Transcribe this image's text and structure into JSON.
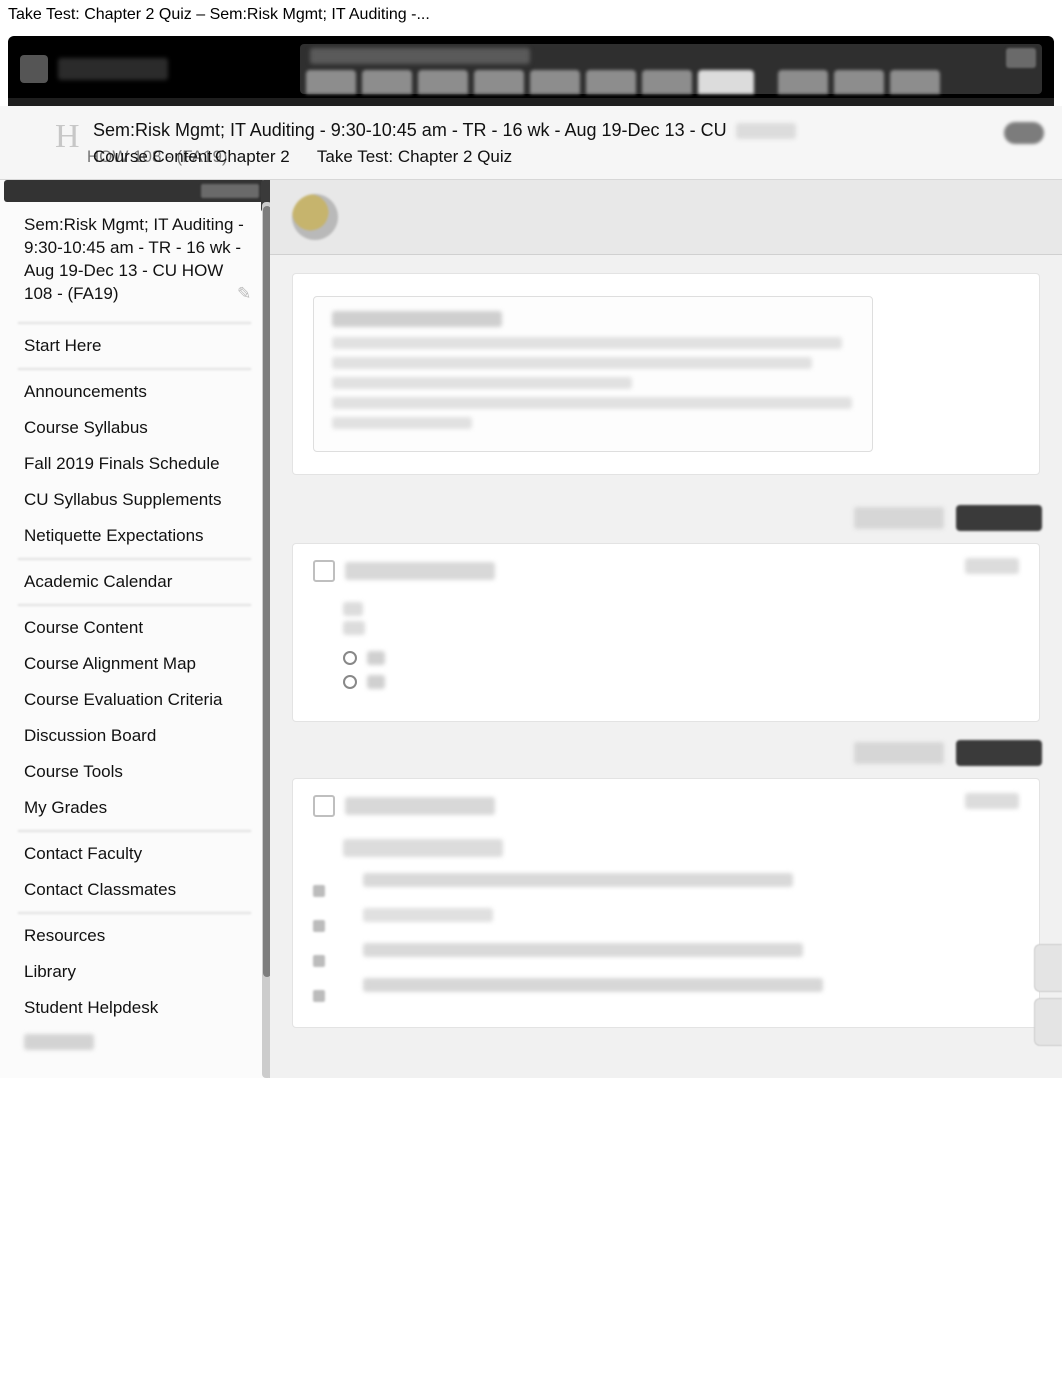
{
  "page_tab_title": "Take Test: Chapter 2 Quiz – Sem:Risk Mgmt; IT Auditing -...",
  "breadcrumb": {
    "home_glyph": "H",
    "line1": "Sem:Risk Mgmt; IT Auditing - 9:30-10:45 am - TR - 16 wk - Aug 19-Dec 13 - CU",
    "line2_suffix": "HOW 108 - (FA19)",
    "segment_course_content": "Course Content",
    "segment_chapter": "Chapter 2",
    "segment_current": "Take Test: Chapter 2 Quiz"
  },
  "sidebar": {
    "home_title": "Sem:Risk Mgmt; IT Auditing - 9:30-10:45 am - TR - 16 wk - Aug 19-Dec 13 - CU HOW 108 - (FA19)",
    "groups": [
      {
        "items": [
          "Start Here"
        ]
      },
      {
        "items": [
          "Announcements",
          "Course Syllabus",
          "Fall 2019 Finals Schedule",
          "CU Syllabus Supplements",
          "Netiquette Expectations"
        ]
      },
      {
        "items": [
          "Academic Calendar"
        ]
      },
      {
        "items": [
          "Course Content",
          "Course Alignment Map",
          "Course Evaluation Criteria",
          "Discussion Board",
          "Course Tools",
          "My Grades"
        ]
      },
      {
        "items": [
          "Contact Faculty",
          "Contact Classmates"
        ]
      },
      {
        "items": [
          "Resources",
          "Library",
          "Student Helpdesk"
        ]
      }
    ]
  },
  "icons": {
    "pencil": "✎"
  }
}
